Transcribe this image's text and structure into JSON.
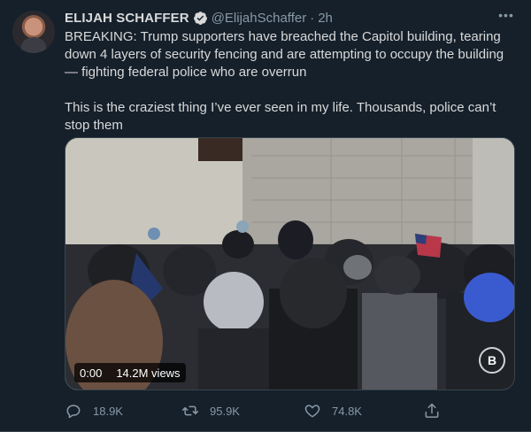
{
  "tweet": {
    "author_name": "ELIJAH SCHAFFER",
    "handle": "@ElijahSchaffer",
    "separator": "·",
    "time": "2h",
    "verified": true,
    "text_p1": "BREAKING: Trump supporters have breached the Capitol building, tearing down 4 layers of security fencing and are attempting to occupy the building — fighting federal police who are overrun",
    "text_p2": "This is the craziest thing I’ve ever seen in my life. Thousands, police can’t stop them",
    "more_icon": "ellipsis-icon"
  },
  "media": {
    "type": "video",
    "duration": "0:00",
    "views": "14.2M views",
    "watermark": "B"
  },
  "actions": {
    "replies": "18.9K",
    "retweets": "95.9K",
    "likes": "74.8K"
  },
  "colors": {
    "background": "#15202b",
    "text": "#d9d9d9",
    "secondary": "#8899a6",
    "verified": "#1da1f2",
    "border": "#38444d"
  }
}
